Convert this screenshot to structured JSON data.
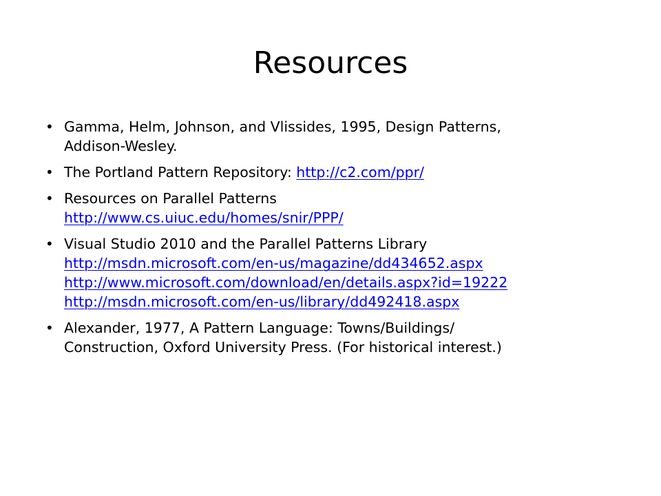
{
  "slide": {
    "title": "Resources",
    "bullets": [
      {
        "lines": [
          "Gamma, Helm, Johnson, and Vlissides, 1995, Design Patterns,",
          "Addison-Wesley."
        ]
      },
      {
        "text": "The Portland Pattern Repository: ",
        "link": "http://c2.com/ppr/"
      },
      {
        "text": "Resources on Parallel Patterns",
        "links": [
          "http://www.cs.uiuc.edu/homes/snir/PPP/"
        ]
      },
      {
        "text": "Visual Studio 2010 and the Parallel Patterns Library",
        "links": [
          "http://msdn.microsoft.com/en-us/magazine/dd434652.aspx",
          "http://www.microsoft.com/download/en/details.aspx?id=19222",
          "http://msdn.microsoft.com/en-us/library/dd492418.aspx"
        ]
      },
      {
        "lines": [
          "Alexander, 1977, A Pattern Language: Towns/Buildings/",
          "Construction, Oxford University Press. (For historical interest.)"
        ]
      }
    ]
  },
  "colors": {
    "link": "#0000ee",
    "text": "#000000",
    "background": "#ffffff"
  }
}
